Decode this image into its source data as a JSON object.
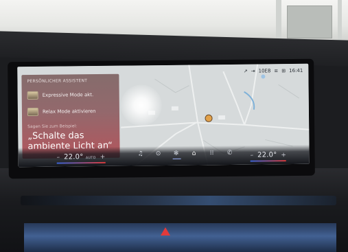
{
  "status_bar": {
    "items": [
      "↗",
      "⇥",
      "10E8",
      "≡",
      "⊞",
      "16:41"
    ]
  },
  "assistant": {
    "title": "PERSÖNLICHER ASSISTENT",
    "option_1": "Expressive Mode akt.",
    "option_2": "Relax Mode aktivieren",
    "hint": "Sagen Sie zum Beispiel:",
    "quote_line_1": "„Schalte das",
    "quote_line_2": "ambiente Licht an“"
  },
  "climate": {
    "left": {
      "minus": "–",
      "value": "22.0",
      "unit": "°",
      "mode": "AUTO",
      "plus": "+"
    },
    "right": {
      "minus": "–",
      "value": "22.0",
      "unit": "°",
      "plus": "+"
    }
  },
  "dock": {
    "items": [
      {
        "icon": "music-icon",
        "glyph": "♫"
      },
      {
        "icon": "phone-icon",
        "glyph": "⊙"
      },
      {
        "icon": "fan-icon",
        "glyph": "✻"
      },
      {
        "icon": "home-icon",
        "glyph": "⌂"
      },
      {
        "icon": "grid-icon",
        "glyph": "⁞⁞"
      },
      {
        "icon": "handset-icon",
        "glyph": "✆"
      }
    ]
  },
  "colors": {
    "accent_blue": "#3a64d8",
    "accent_red": "#d83a3a",
    "assistant_bg": "#b04a52"
  }
}
